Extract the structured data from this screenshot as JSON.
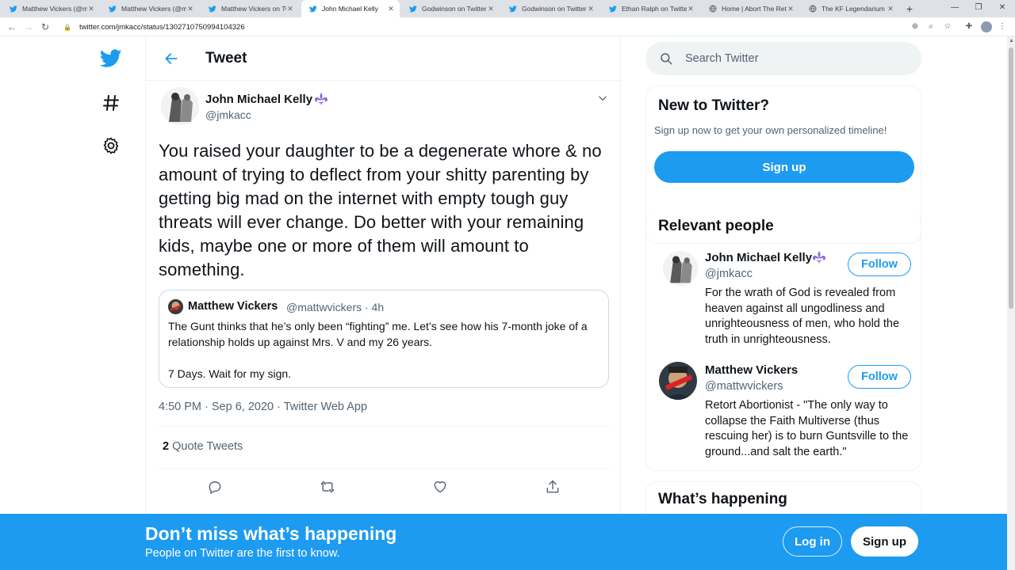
{
  "browser": {
    "tabs": [
      {
        "title": "Matthew Vickers (@mat",
        "active": false
      },
      {
        "title": "Matthew Vickers (@ma",
        "active": false
      },
      {
        "title": "Matthew Vickers on Tw",
        "active": false
      },
      {
        "title": "John Michael Kelly",
        "active": true
      },
      {
        "title": "Godwinson on Twitter",
        "active": false
      },
      {
        "title": "Godwinson on Twitter",
        "active": false
      },
      {
        "title": "Ethan Ralph on Twitter",
        "active": false
      },
      {
        "title": "Home | Abort The Reto",
        "active": false
      },
      {
        "title": "The KF Legendarium |",
        "active": false
      }
    ],
    "url": "twitter.com/jmkacc/status/1302710750994104326"
  },
  "header": {
    "title": "Tweet"
  },
  "tweet": {
    "author_name": "John Michael Kelly",
    "author_handle": "@jmkacc",
    "text": "You raised your daughter to be a degenerate whore & no amount of trying to deflect from your shitty parenting by getting big mad on the internet with empty tough guy threats will ever change. Do better with your remaining kids, maybe one or more of them will amount to something.",
    "quote": {
      "name": "Matthew Vickers",
      "handle_time": "@mattwvickers · 4h",
      "text": "The Gunt thinks that he’s only been “fighting” me.  Let’s see how his 7-month joke of a relationship holds up against Mrs. V and my 26 years.\n\n7 Days.  Wait for my sign."
    },
    "timestamp": "4:50 PM · Sep 6, 2020 · Twitter Web App",
    "quote_tweets_count": "2",
    "quote_tweets_label": "Quote Tweets"
  },
  "search": {
    "placeholder": "Search Twitter"
  },
  "new_to_twitter": {
    "title": "New to Twitter?",
    "subtitle": "Sign up now to get your own personalized timeline!",
    "signup_label": "Sign up"
  },
  "relevant_people": {
    "title": "Relevant people",
    "people": [
      {
        "name": "John Michael Kelly",
        "handle": "@jmkacc",
        "bio": "For the wrath of God is revealed from heaven against all ungodliness and unrighteousness of men, who hold the truth in unrighteousness.",
        "follow_label": "Follow"
      },
      {
        "name": "Matthew Vickers",
        "handle": "@mattwvickers",
        "bio": "Retort Abortionist - \"The only way to collapse the Faith Multiverse (thus rescuing her) is to burn Guntsville to the ground...and salt the earth.\"",
        "follow_label": "Follow"
      }
    ]
  },
  "whats_happening": {
    "title": "What’s happening"
  },
  "banner": {
    "title": "Don’t miss what’s happening",
    "subtitle": "People on Twitter are the first to know.",
    "login_label": "Log in",
    "signup_label": "Sign up"
  },
  "colors": {
    "brand": "#1d9bf0",
    "text": "#0f1419",
    "secondary": "#536471",
    "badge": "#8b6ad6"
  },
  "icons": [
    "twitter-logo-icon",
    "hashtag-icon",
    "settings-icon",
    "back-arrow-icon",
    "chevron-down-icon",
    "search-icon",
    "reply-icon",
    "retweet-icon",
    "like-icon",
    "share-icon",
    "fleur-de-lis-icon"
  ]
}
